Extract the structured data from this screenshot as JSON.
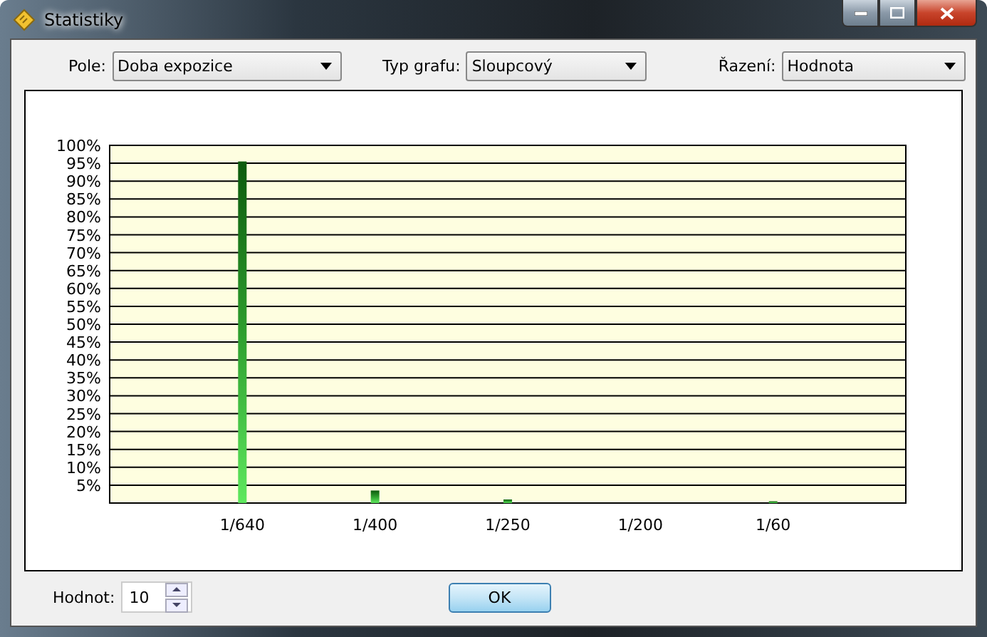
{
  "window": {
    "title": "Statistiky"
  },
  "fields": [
    {
      "label": "Pole:",
      "value": "Doba expozice"
    },
    {
      "label": "Typ grafu:",
      "value": "Sloupcový"
    },
    {
      "label": "Řazení:",
      "value": "Hodnota"
    }
  ],
  "chart": {
    "chart_data": {
      "type": "bar",
      "categories": [
        "1/640",
        "1/400",
        "1/250",
        "1/200",
        "1/60"
      ],
      "grid": true,
      "series": [
        {
          "color": "#2e9e2e",
          "values": [
            95.5,
            3.5,
            1,
            0,
            0.5
          ]
        }
      ],
      "ylim": [
        0,
        100
      ],
      "yticks": [
        {
          "value": 5,
          "label": "5%"
        },
        {
          "value": 10,
          "label": "10%"
        },
        {
          "value": 15,
          "label": "15%"
        },
        {
          "value": 20,
          "label": "20%"
        },
        {
          "value": 25,
          "label": "25%"
        },
        {
          "value": 30,
          "label": "30%"
        },
        {
          "value": 35,
          "label": "35%"
        },
        {
          "value": 40,
          "label": "40%"
        },
        {
          "value": 45,
          "label": "45%"
        },
        {
          "value": 50,
          "label": "50%"
        },
        {
          "value": 55,
          "label": "55%"
        },
        {
          "value": 60,
          "label": "60%"
        },
        {
          "value": 65,
          "label": "65%"
        },
        {
          "value": 70,
          "label": "70%"
        },
        {
          "value": 75,
          "label": "75%"
        },
        {
          "value": 80,
          "label": "80%"
        },
        {
          "value": 85,
          "label": "85%"
        },
        {
          "value": 90,
          "label": "90%"
        },
        {
          "value": 95,
          "label": "95%"
        },
        {
          "value": 100,
          "label": "100%"
        }
      ]
    }
  },
  "count": {
    "label": "Hodnot:",
    "value": "10"
  },
  "buttons": [
    "OK"
  ]
}
